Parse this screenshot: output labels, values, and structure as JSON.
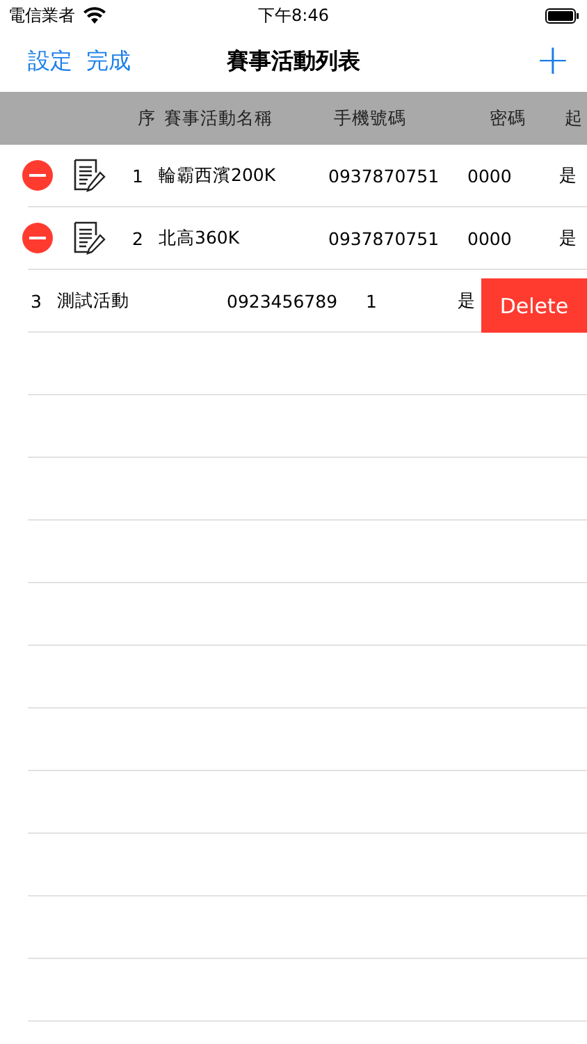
{
  "status_bar": {
    "carrier": "電信業者",
    "time": "下午8:46"
  },
  "nav": {
    "left_buttons": [
      "設定",
      "完成"
    ],
    "title": "賽事活動列表",
    "add_button": "+"
  },
  "table": {
    "columns": [
      "序",
      "賽事活動名稱",
      "手機號碼",
      "密碼",
      "起"
    ],
    "rows": [
      {
        "cells": [
          "1",
          "輪霸西濱200K",
          "0937870751",
          "0000",
          "是"
        ]
      },
      {
        "cells": [
          "2",
          "北高360K",
          "0937870751",
          "0000",
          "是"
        ]
      }
    ],
    "swiped_row": {
      "texts": [
        "3",
        "測試活動",
        "0923456789",
        "1",
        "是"
      ],
      "delete_label": "Delete"
    }
  }
}
